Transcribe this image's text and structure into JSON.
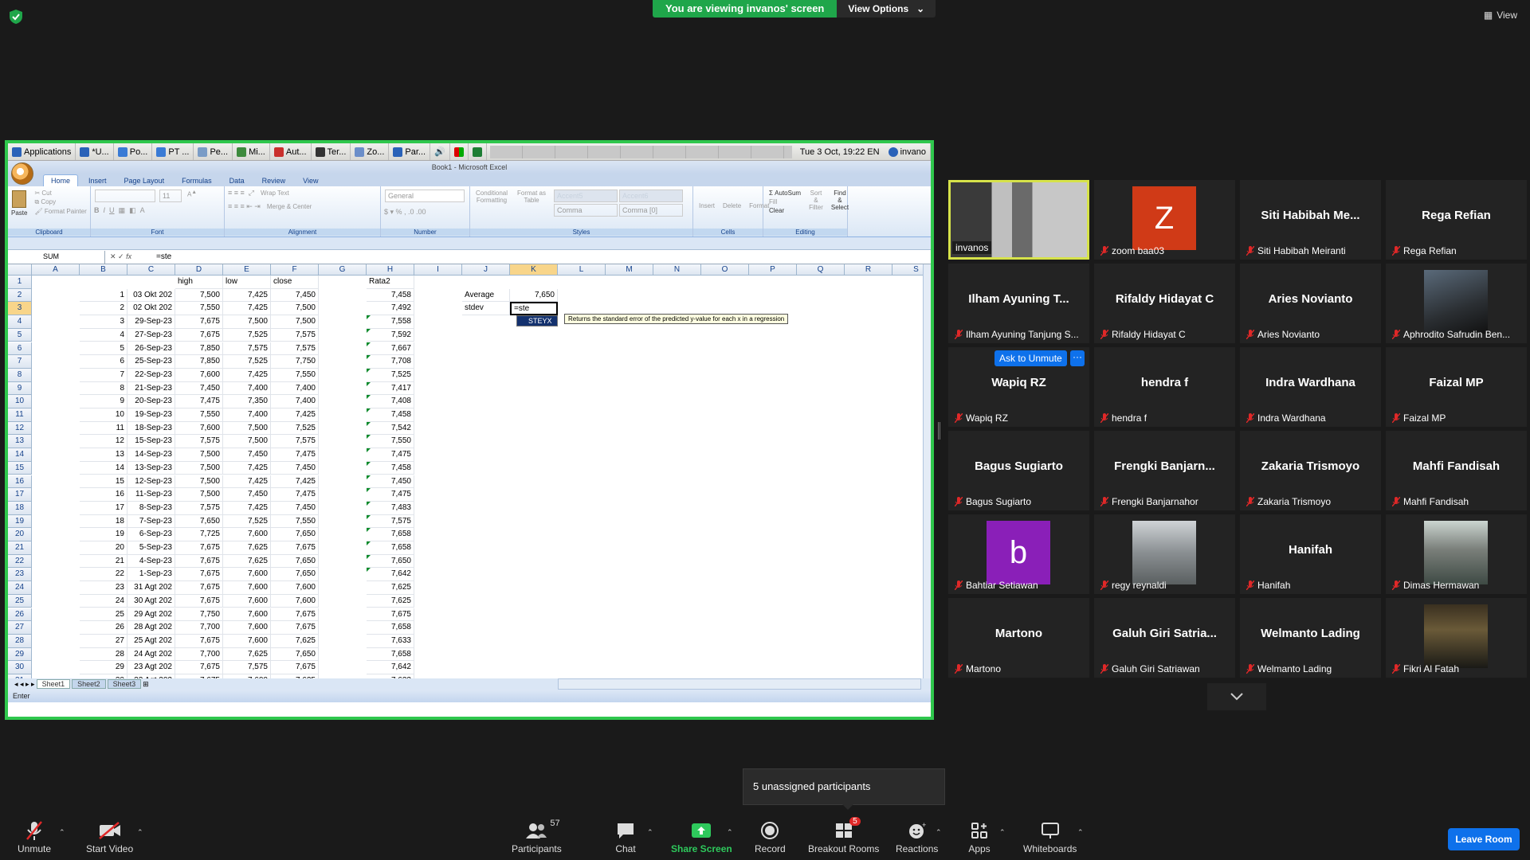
{
  "banner": {
    "text": "You are viewing invanos' screen",
    "view_options": "View Options"
  },
  "top_right": {
    "view": "View"
  },
  "taskbar": {
    "items": [
      "Applications",
      "*U...",
      "Po...",
      "PT ...",
      "Pe...",
      "Mi...",
      "Aut...",
      "Ter...",
      "Zo...",
      "Par..."
    ],
    "clock": "Tue  3 Oct, 19:22 EN",
    "user": "invano"
  },
  "excel": {
    "title": "Book1 - Microsoft Excel",
    "tabs": [
      "Home",
      "Insert",
      "Page Layout",
      "Formulas",
      "Data",
      "Review",
      "View"
    ],
    "groups": [
      "Clipboard",
      "Font",
      "Alignment",
      "Number",
      "Styles",
      "Cells",
      "Editing"
    ],
    "clipboard": [
      "Paste",
      "Cut",
      "Copy",
      "Format Painter"
    ],
    "font": {
      "size": "11"
    },
    "alignment": [
      "Wrap Text",
      "Merge & Center"
    ],
    "number": {
      "format": "General"
    },
    "styles": [
      "Conditional Formatting",
      "Format as Table",
      "Accent5",
      "Accent6",
      "Comma",
      "Comma [0]"
    ],
    "cells": [
      "Insert",
      "Delete",
      "Format"
    ],
    "editing": [
      "AutoSum",
      "Fill",
      "Clear",
      "Sort & Filter",
      "Find & Select"
    ],
    "name_box": "SUM",
    "formula": "=ste",
    "columns": [
      "A",
      "B",
      "C",
      "D",
      "E",
      "F",
      "G",
      "H",
      "I",
      "J",
      "K",
      "L",
      "M",
      "N",
      "O",
      "P",
      "Q",
      "R",
      "S"
    ],
    "header_row": {
      "D": "high",
      "E": "low",
      "F": "close",
      "H": "Rata2"
    },
    "rows": [
      [
        "1",
        "03 Okt 202",
        "7,500",
        "7,425",
        "7,450",
        "7,458"
      ],
      [
        "2",
        "02 Okt 202",
        "7,550",
        "7,425",
        "7,500",
        "7,492"
      ],
      [
        "3",
        "29-Sep-23",
        "7,675",
        "7,500",
        "7,500",
        "7,558"
      ],
      [
        "4",
        "27-Sep-23",
        "7,675",
        "7,525",
        "7,575",
        "7,592"
      ],
      [
        "5",
        "26-Sep-23",
        "7,850",
        "7,575",
        "7,575",
        "7,667"
      ],
      [
        "6",
        "25-Sep-23",
        "7,850",
        "7,525",
        "7,750",
        "7,708"
      ],
      [
        "7",
        "22-Sep-23",
        "7,600",
        "7,425",
        "7,550",
        "7,525"
      ],
      [
        "8",
        "21-Sep-23",
        "7,450",
        "7,400",
        "7,400",
        "7,417"
      ],
      [
        "9",
        "20-Sep-23",
        "7,475",
        "7,350",
        "7,400",
        "7,408"
      ],
      [
        "10",
        "19-Sep-23",
        "7,550",
        "7,400",
        "7,425",
        "7,458"
      ],
      [
        "11",
        "18-Sep-23",
        "7,600",
        "7,500",
        "7,525",
        "7,542"
      ],
      [
        "12",
        "15-Sep-23",
        "7,575",
        "7,500",
        "7,575",
        "7,550"
      ],
      [
        "13",
        "14-Sep-23",
        "7,500",
        "7,450",
        "7,475",
        "7,475"
      ],
      [
        "14",
        "13-Sep-23",
        "7,500",
        "7,425",
        "7,450",
        "7,458"
      ],
      [
        "15",
        "12-Sep-23",
        "7,500",
        "7,425",
        "7,425",
        "7,450"
      ],
      [
        "16",
        "11-Sep-23",
        "7,500",
        "7,450",
        "7,475",
        "7,475"
      ],
      [
        "17",
        "8-Sep-23",
        "7,575",
        "7,425",
        "7,450",
        "7,483"
      ],
      [
        "18",
        "7-Sep-23",
        "7,650",
        "7,525",
        "7,550",
        "7,575"
      ],
      [
        "19",
        "6-Sep-23",
        "7,725",
        "7,600",
        "7,650",
        "7,658"
      ],
      [
        "20",
        "5-Sep-23",
        "7,675",
        "7,625",
        "7,675",
        "7,658"
      ],
      [
        "21",
        "4-Sep-23",
        "7,675",
        "7,625",
        "7,650",
        "7,650"
      ],
      [
        "22",
        "1-Sep-23",
        "7,675",
        "7,600",
        "7,650",
        "7,642"
      ],
      [
        "23",
        "31 Agt 202",
        "7,675",
        "7,600",
        "7,600",
        "7,625"
      ],
      [
        "24",
        "30 Agt 202",
        "7,675",
        "7,600",
        "7,600",
        "7,625"
      ],
      [
        "25",
        "29 Agt 202",
        "7,750",
        "7,600",
        "7,675",
        "7,675"
      ],
      [
        "26",
        "28 Agt 202",
        "7,700",
        "7,600",
        "7,675",
        "7,658"
      ],
      [
        "27",
        "25 Agt 202",
        "7,675",
        "7,600",
        "7,625",
        "7,633"
      ],
      [
        "28",
        "24 Agt 202",
        "7,700",
        "7,625",
        "7,650",
        "7,658"
      ],
      [
        "29",
        "23 Agt 202",
        "7,675",
        "7,575",
        "7,675",
        "7,642"
      ],
      [
        "30",
        "22 Agt 202",
        "7,675",
        "7,600",
        "7,625",
        "7,633"
      ]
    ],
    "stats": {
      "average_label": "Average",
      "average_value": "7,650",
      "stdev_label": "stdev",
      "active_input": "=ste"
    },
    "autocomplete": {
      "item": "STEYX",
      "tooltip": "Returns the standard error of the predicted y-value for each x in a regression"
    },
    "sheets": [
      "Sheet1",
      "Sheet2",
      "Sheet3"
    ],
    "status": "Enter"
  },
  "participants": [
    {
      "id": "invanos",
      "display": "",
      "label": "invanos",
      "kind": "self"
    },
    {
      "id": "zoom-baa03",
      "display": "Z",
      "label": "zoom baa03",
      "kind": "avatar",
      "color": "#d03a17"
    },
    {
      "id": "siti",
      "display": "Siti  Habibah  Me...",
      "label": "Siti Habibah Meiranti",
      "kind": "name"
    },
    {
      "id": "rega",
      "display": "Rega Refian",
      "label": "Rega Refian",
      "kind": "name"
    },
    {
      "id": "ilham",
      "display": "Ilham Ayuning T...",
      "label": "Ilham Ayuning Tanjung S...",
      "kind": "name"
    },
    {
      "id": "rifaldy",
      "display": "Rifaldy Hidayat C",
      "label": "Rifaldy Hidayat C",
      "kind": "name"
    },
    {
      "id": "aries",
      "display": "Aries Novianto",
      "label": "Aries Novianto",
      "kind": "name"
    },
    {
      "id": "aphrodito",
      "display": "",
      "label": "Aphrodito Safrudin Ben...",
      "kind": "photo"
    },
    {
      "id": "wapiq",
      "display": "Wapiq RZ",
      "label": "Wapiq RZ",
      "kind": "name"
    },
    {
      "id": "hendra",
      "display": "hendra f",
      "label": "hendra f",
      "kind": "name"
    },
    {
      "id": "indra",
      "display": "Indra Wardhana",
      "label": "Indra Wardhana",
      "kind": "name"
    },
    {
      "id": "faizal",
      "display": "Faizal MP",
      "label": "Faizal MP",
      "kind": "name"
    },
    {
      "id": "bagus",
      "display": "Bagus Sugiarto",
      "label": "Bagus Sugiarto",
      "kind": "name"
    },
    {
      "id": "frengki",
      "display": "Frengki  Banjarn...",
      "label": "Frengki Banjarnahor",
      "kind": "name"
    },
    {
      "id": "zakaria",
      "display": "Zakaria Trismoyo",
      "label": "Zakaria Trismoyo",
      "kind": "name"
    },
    {
      "id": "mahfi",
      "display": "Mahfi Fandisah",
      "label": "Mahfi Fandisah",
      "kind": "name"
    },
    {
      "id": "bahtiar",
      "display": "b",
      "label": "Bahtiar Setiawan",
      "kind": "avatar",
      "color": "#8a1fb8"
    },
    {
      "id": "regy",
      "display": "",
      "label": "regy reynaldi",
      "kind": "photo"
    },
    {
      "id": "hanifah",
      "display": "Hanifah",
      "label": "Hanifah",
      "kind": "name"
    },
    {
      "id": "dimas",
      "display": "",
      "label": "Dimas Hermawan",
      "kind": "photo"
    },
    {
      "id": "martono",
      "display": "Martono",
      "label": "Martono",
      "kind": "name"
    },
    {
      "id": "galuh",
      "display": "Galuh Giri Satria...",
      "label": "Galuh Giri Satriawan",
      "kind": "name"
    },
    {
      "id": "welmanto",
      "display": "Welmanto Lading",
      "label": "Welmanto Lading",
      "kind": "name"
    },
    {
      "id": "fikri",
      "display": "",
      "label": "Fikri Al Fatah",
      "kind": "photo"
    }
  ],
  "ask_to_unmute": "Ask to Unmute",
  "more": "···",
  "unassigned": "5 unassigned participants",
  "toolbar": {
    "unmute": "Unmute",
    "start_video": "Start Video",
    "participants": "Participants",
    "participants_count": "57",
    "chat": "Chat",
    "share_screen": "Share Screen",
    "record": "Record",
    "breakout_rooms": "Breakout Rooms",
    "breakout_badge": "5",
    "reactions": "Reactions",
    "apps": "Apps",
    "whiteboards": "Whiteboards",
    "leave": "Leave Room"
  },
  "colors": {
    "share_green": "#2fc74d",
    "zoom_blue": "#0e71eb",
    "mute_red": "#e02828"
  }
}
